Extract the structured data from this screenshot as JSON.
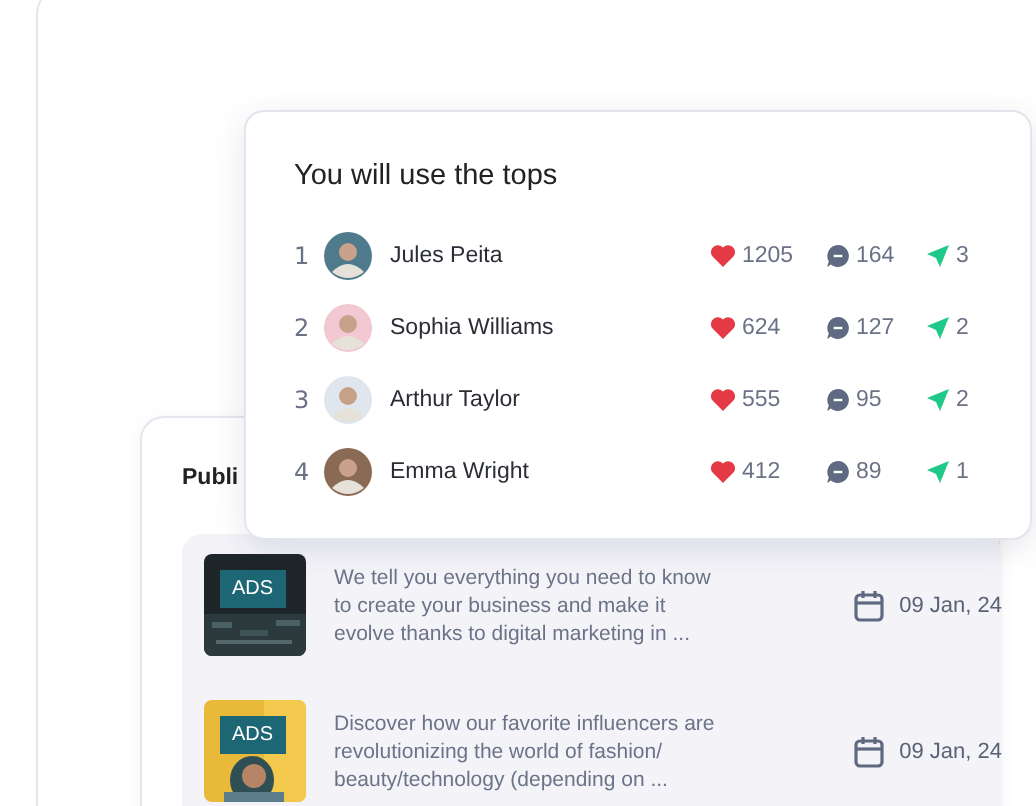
{
  "top_card": {
    "title": "You will use the tops",
    "rows": [
      {
        "rank": "1",
        "name": "Jules Peita",
        "likes": "1205",
        "comments": "164",
        "shares": "3"
      },
      {
        "rank": "2",
        "name": "Sophia Williams",
        "likes": "624",
        "comments": "127",
        "shares": "2"
      },
      {
        "rank": "3",
        "name": "Arthur Taylor",
        "likes": "555",
        "comments": "95",
        "shares": "2"
      },
      {
        "rank": "4",
        "name": "Emma Wright",
        "likes": "412",
        "comments": "89",
        "shares": "1"
      }
    ]
  },
  "publications": {
    "title": "Publi",
    "posts": [
      {
        "badge": "ADS",
        "text": "We tell you everything you need to know to create your business and make it evolve thanks to digital marketing in ...",
        "date": "09 Jan, 24"
      },
      {
        "badge": "ADS",
        "text": "Discover how our favorite influencers are revolutionizing the world of fashion/ beauty/technology (depending on ...",
        "date": "09 Jan, 24"
      }
    ]
  }
}
